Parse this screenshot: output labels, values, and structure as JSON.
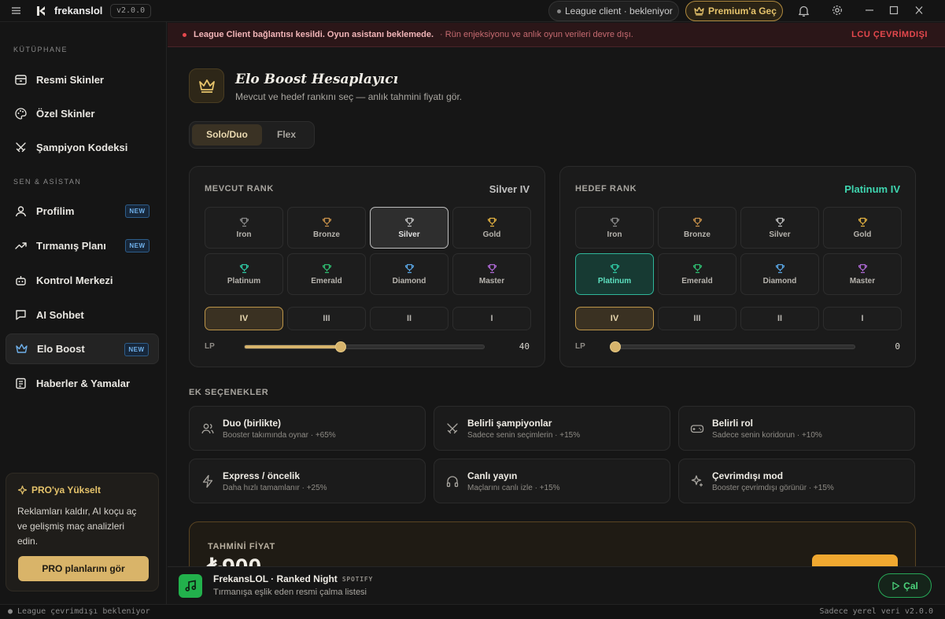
{
  "titlebar": {
    "app_name": "frekanslol",
    "version": "v2.0.0",
    "client_status": "League client · bekleniyor",
    "premium_label": "Premium'a Geç"
  },
  "sidebar": {
    "library_label": "KÜTÜPHANE",
    "library_items": [
      {
        "label": "Resmi Skinler",
        "icon": "box-icon"
      },
      {
        "label": "Özel Skinler",
        "icon": "palette-icon"
      },
      {
        "label": "Şampiyon Kodeksi",
        "icon": "swords-icon"
      }
    ],
    "assistant_label": "SEN & ASİSTAN",
    "assistant_items": [
      {
        "label": "Profilim",
        "icon": "user-icon",
        "badge": "NEW"
      },
      {
        "label": "Tırmanış Planı",
        "icon": "trend-icon",
        "badge": "NEW"
      },
      {
        "label": "Kontrol Merkezi",
        "icon": "bot-icon"
      },
      {
        "label": "AI Sohbet",
        "icon": "chat-icon"
      },
      {
        "label": "Elo Boost",
        "icon": "crown-icon",
        "badge": "NEW",
        "active": true
      },
      {
        "label": "Haberler & Yamalar",
        "icon": "news-icon"
      }
    ],
    "pro": {
      "title": "PRO'ya Yükselt",
      "text": "Reklamları kaldır, AI koçu aç ve gelişmiş maç analizleri edin.",
      "button": "PRO planlarını gör"
    }
  },
  "banner": {
    "title": "League Client bağlantısı kesildi. Oyun asistanı beklemede.",
    "detail": "· Rün enjeksiyonu ve anlık oyun verileri devre dışı.",
    "status": "LCU ÇEVRİMDIŞI"
  },
  "header": {
    "title": "Elo Boost Hesaplayıcı",
    "subtitle": "Mevcut ve hedef rankını seç — anlık tahmini fiyatı gör."
  },
  "modes": [
    {
      "label": "Solo/Duo",
      "active": true
    },
    {
      "label": "Flex",
      "active": false
    }
  ],
  "tiers": [
    {
      "name": "Iron",
      "color": "#8a8a8a"
    },
    {
      "name": "Bronze",
      "color": "#c8914a"
    },
    {
      "name": "Silver",
      "color": "#c0c0c0"
    },
    {
      "name": "Gold",
      "color": "#e1b040"
    },
    {
      "name": "Platinum",
      "color": "#2fc9a4"
    },
    {
      "name": "Emerald",
      "color": "#2fbf72"
    },
    {
      "name": "Diamond",
      "color": "#5aa8e8"
    },
    {
      "name": "Master",
      "color": "#b06ad8"
    }
  ],
  "divisions": [
    "IV",
    "III",
    "II",
    "I"
  ],
  "current": {
    "label": "MEVCUT RANK",
    "selected_text": "Silver IV",
    "selected_color": "#c0c0c0",
    "tier_index": 2,
    "division_index": 0,
    "lp_label": "LP",
    "lp": 40,
    "lp_max": 100
  },
  "target": {
    "label": "HEDEF RANK",
    "selected_text": "Platinum IV",
    "selected_color": "#3fd6b0",
    "tier_index": 4,
    "division_index": 0,
    "lp_label": "LP",
    "lp": 0,
    "lp_max": 100
  },
  "extras": {
    "title": "EK SEÇENEKLER",
    "options": [
      {
        "title": "Duo (birlikte)",
        "sub": "Booster takımında oynar · +65%",
        "icon": "users-icon"
      },
      {
        "title": "Belirli şampiyonlar",
        "sub": "Sadece senin seçimlerin · +15%",
        "icon": "swords-icon"
      },
      {
        "title": "Belirli rol",
        "sub": "Sadece senin koridorun · +10%",
        "icon": "gamepad-icon"
      },
      {
        "title": "Express / öncelik",
        "sub": "Daha hızlı tamamlanır · +25%",
        "icon": "bolt-icon"
      },
      {
        "title": "Canlı yayın",
        "sub": "Maçlarını canlı izle · +15%",
        "icon": "headphones-icon"
      },
      {
        "title": "Çevrimdışı mod",
        "sub": "Booster çevrimdışı görünür · +15%",
        "icon": "sparkles-icon"
      }
    ]
  },
  "price": {
    "label": "TAHMİNİ FİYAT",
    "value": "₺900"
  },
  "player": {
    "title": "FrekansLOL · Ranked Night",
    "source": "SPOTIFY",
    "subtitle": "Tırmanışa eşlik eden resmi çalma listesi",
    "play_label": "Çal"
  },
  "statusbar": {
    "left": "● League çevrimdışı  bekleniyor",
    "right": "Sadece yerel veri  v2.0.0"
  }
}
